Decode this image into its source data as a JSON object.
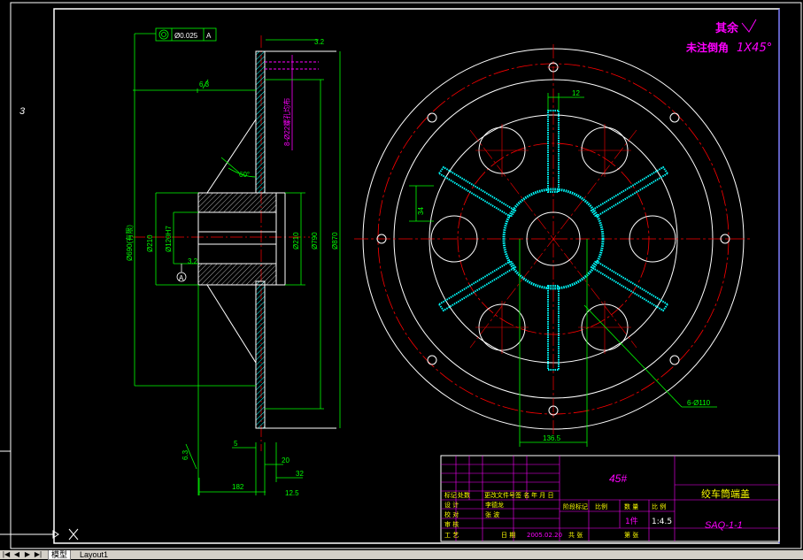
{
  "drawing": {
    "sheet_number": "3",
    "notes": {
      "remaining_label": "其余",
      "chamfer_label": "未注倒角",
      "chamfer_value": "1X45°"
    },
    "section_view": {
      "geo_tolerance": {
        "symbol": "◎",
        "value": "Ø0.025",
        "datum": "A"
      },
      "roughness_top": "3.2",
      "roughness_mid": "6.3",
      "roughness_left": "6.3",
      "roughness_bottom": "12.5",
      "roughness_hub": "3.2",
      "angle_60": "60°",
      "hole_spec": "8-Ø22螺孔均布",
      "dim_d690": "Ø690(有限)",
      "dim_d210": "Ø210",
      "dim_d120": "Ø120H7",
      "dim_d210b": "Ø210",
      "dim_d790": "Ø790",
      "dim_d870": "Ø870",
      "dim_5": "5",
      "dim_20": "20",
      "dim_32": "32",
      "dim_182": "182",
      "datum_a": "A"
    },
    "front_view": {
      "dim_12": "12",
      "dim_slot": "34",
      "dim_136_5": "136.5",
      "hole_callout": "6-Ø110"
    },
    "title_block": {
      "material": "45#",
      "part_name": "绞车筒端盖",
      "drawing_no": "SAQ-1-1",
      "scale_label": "比 例",
      "scale_value": "1:4.5",
      "qty_label": "数 量",
      "qty_value": "1件",
      "weight_label": "重 量",
      "sheet_label": "共 张",
      "sheet2_label": "第 张",
      "date_label": "日 期",
      "date_value": "2005.02.20",
      "rows": [
        {
          "role": "设 计",
          "name": "李德龙"
        },
        {
          "role": "校 对",
          "name": "张 波"
        },
        {
          "role": "审 核",
          "name": ""
        },
        {
          "role": "工 艺",
          "name": ""
        }
      ],
      "header_cells": [
        "标记",
        "处数",
        "更改文件号",
        "签 名",
        "年 月 日"
      ],
      "process_label": "阶段标记",
      "ratio_label": "比例"
    }
  },
  "layout_tabs": {
    "model_label": "模型",
    "layout1_label": "Layout1"
  },
  "colors": {
    "background": "#000000",
    "green": "#00ff00",
    "white": "#ffffff",
    "red": "#ff0000",
    "cyan": "#00ffff",
    "magenta": "#ff00ff",
    "blue": "#4040ff"
  }
}
